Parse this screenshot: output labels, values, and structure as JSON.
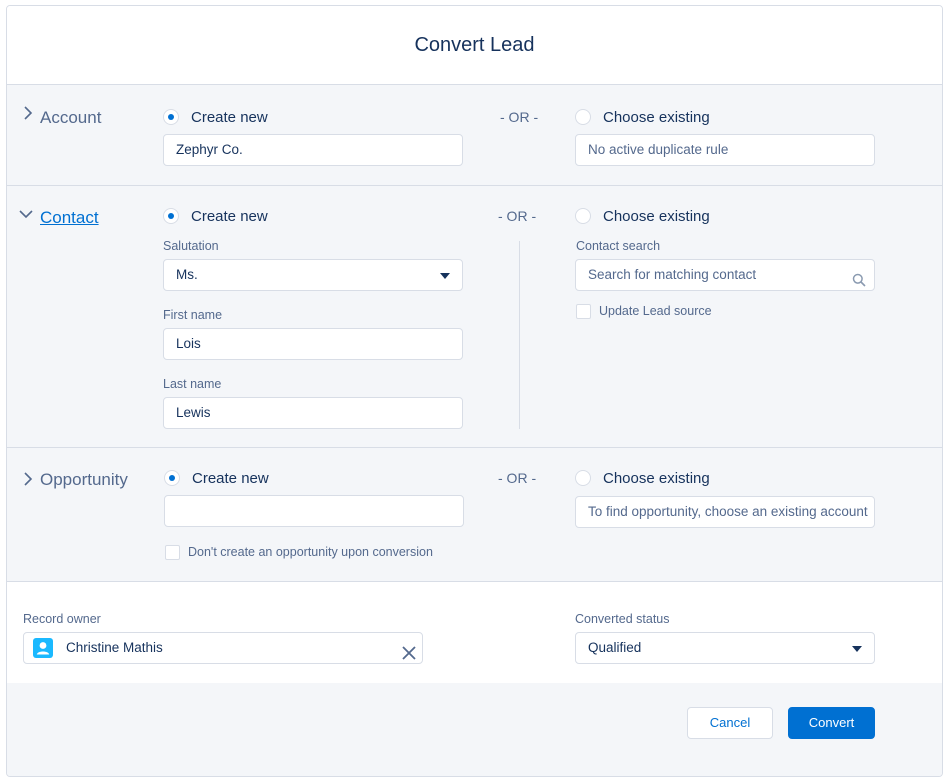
{
  "modal": {
    "title": "Convert Lead"
  },
  "or_text": "- OR -",
  "account": {
    "title": "Account",
    "create_new_label": "Create new",
    "create_new_selected": true,
    "name_value": "Zephyr Co.",
    "choose_existing_label": "Choose existing",
    "existing_value": "No active duplicate rule"
  },
  "contact": {
    "title": "Contact",
    "create_new_label": "Create new",
    "create_new_selected": true,
    "salutation_label": "Salutation",
    "salutation_value": "Ms.",
    "first_name_label": "First name",
    "first_name_value": "Lois",
    "last_name_label": "Last name",
    "last_name_value": "Lewis",
    "choose_existing_label": "Choose existing",
    "search_label": "Contact search",
    "search_placeholder": "Search for matching contact",
    "update_lead_source_label": "Update Lead source"
  },
  "opportunity": {
    "title": "Opportunity",
    "create_new_label": "Create new",
    "create_new_selected": true,
    "name_value": "",
    "dont_create_label": "Don't create an opportunity upon conversion",
    "choose_existing_label": "Choose existing",
    "existing_value": "To find opportunity, choose an existing account"
  },
  "record_owner": {
    "label": "Record owner",
    "value": "Christine Mathis"
  },
  "converted_status": {
    "label": "Converted status",
    "value": "Qualified"
  },
  "footer": {
    "cancel_label": "Cancel",
    "convert_label": "Convert"
  },
  "colors": {
    "brand": "#0070d2",
    "text": "#16325c",
    "muted": "#54698d",
    "border": "#d8dde6",
    "section_bg": "#f4f6f9",
    "avatar": "#1ab9ff"
  }
}
